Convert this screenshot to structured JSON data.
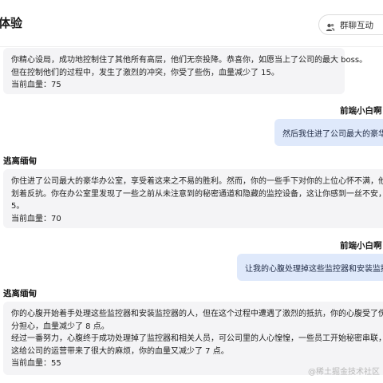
{
  "header": {
    "title": "体验",
    "group_button_label": "群聊互动",
    "group_icon": "group-chat-icon"
  },
  "messages": [
    {
      "role": "bot",
      "lines": [
        "你精心设局，成功地控制住了其他所有高层，他们无奈投降。恭喜你，如愿当上了公司的最大 boss。",
        "但在控制他们的过程中，发生了激烈的冲突，你受了些伤，血量减少了 15。",
        "当前血量：75"
      ]
    },
    {
      "role": "user",
      "speaker": "前端小白啊",
      "text": "然后我住进了公司最大的豪华办"
    },
    {
      "role": "bot",
      "speaker": "逃离缅甸",
      "lines": [
        "你住进了公司最大的豪华办公室，享受着这来之不易的胜利。然而，你的一些手下对你的上位心怀不满，他们在暗中",
        "划着反抗。你在办公室里发现了一些之前从未注意到的秘密通道和隐藏的监控设备，这让你感到一丝不安，血量减少",
        "5。",
        "当前血量：70"
      ]
    },
    {
      "role": "user",
      "speaker": "前端小白啊",
      "text": "让我的心腹处理掉这些监控器和安装监控器的"
    },
    {
      "role": "bot",
      "speaker": "逃离缅甸",
      "lines": [
        "你的心腹开始着手处理这些监控器和安装监控器的人，但在这个过程中遭遇了激烈的抵抗，你的心腹受了伤，这让你",
        "分担心，血量减少了 8 点。",
        "经过一番努力，心腹终于成功处理掉了监控器和相关人员，可公司里的人心惶惶，一些员工开始秘密串联，准备罢工",
        "这给公司的运营带来了很大的麻烦，你的血量又减少了 7 点。",
        "当前血量：55"
      ]
    }
  ],
  "watermark": "@稀土掘金技术社区"
}
